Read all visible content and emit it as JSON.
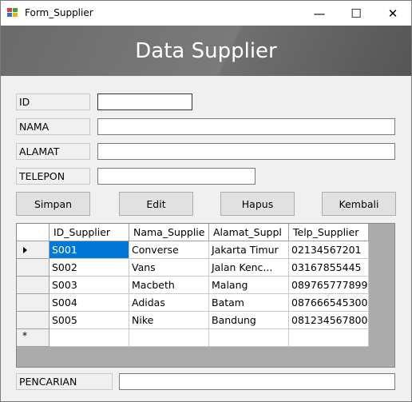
{
  "window": {
    "title": "Form_Supplier",
    "minimize": "—",
    "maximize": "☐",
    "close": "✕"
  },
  "banner": {
    "title": "Data Supplier"
  },
  "form": {
    "id_label": "ID",
    "id_value": "",
    "nama_label": "NAMA",
    "nama_value": "",
    "alamat_label": "ALAMAT",
    "alamat_value": "",
    "telepon_label": "TELEPON",
    "telepon_value": ""
  },
  "buttons": {
    "simpan": "Simpan",
    "edit": "Edit",
    "hapus": "Hapus",
    "kembali": "Kembali"
  },
  "grid": {
    "columns": [
      "ID_Supplier",
      "Nama_Supplie",
      "Alamat_Suppl",
      "Telp_Supplier"
    ],
    "rows": [
      [
        "S001",
        "Converse",
        "Jakarta Timur",
        "02134567201"
      ],
      [
        "S002",
        "Vans",
        "Jalan Kenc...",
        "03167855445"
      ],
      [
        "S003",
        "Macbeth",
        "Malang",
        "089765777899"
      ],
      [
        "S004",
        "Adidas",
        "Batam",
        "087666545300"
      ],
      [
        "S005",
        "Nike",
        "Bandung",
        "081234567800"
      ]
    ],
    "new_row_marker": "*",
    "selected_row": 0
  },
  "search": {
    "label": "PENCARIAN",
    "value": ""
  },
  "colors": {
    "selection": "#0078d7",
    "banner": "#6b6b6b"
  }
}
